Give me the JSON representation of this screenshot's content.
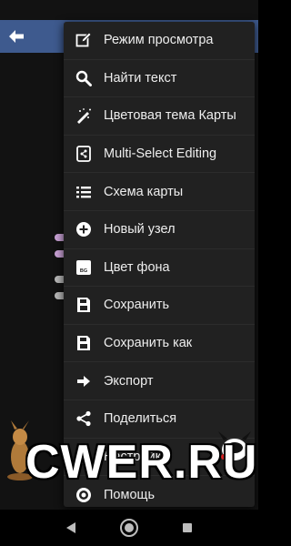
{
  "menu": {
    "items": [
      {
        "label": "Режим просмотра",
        "icon": "edit-icon"
      },
      {
        "label": "Найти текст",
        "icon": "search-icon"
      },
      {
        "label": "Цветовая тема Карты",
        "icon": "magic-brush-icon"
      },
      {
        "label": "Multi-Select Editing",
        "icon": "multi-select-icon"
      },
      {
        "label": "Схема карты",
        "icon": "list-icon"
      },
      {
        "label": "Новый узел",
        "icon": "add-circle-icon"
      },
      {
        "label": "Цвет фона",
        "icon": "bg-color-icon",
        "icon_text": "BG"
      },
      {
        "label": "Сохранить",
        "icon": "save-icon"
      },
      {
        "label": "Сохранить как",
        "icon": "save-as-icon"
      },
      {
        "label": "Экспорт",
        "icon": "export-arrow-icon"
      },
      {
        "label": "Поделиться",
        "icon": "share-icon"
      },
      {
        "label": "Настройки",
        "icon": "settings-icon"
      },
      {
        "label": "Помощь",
        "icon": "help-icon"
      }
    ]
  },
  "watermark": {
    "text": "CWER.RU"
  },
  "colors": {
    "appbar": "#3e5a8e",
    "menu_bg": "#212121",
    "text": "#eeeeee",
    "node_purple": "#c9a2d6",
    "node_gray": "#b8b8b8"
  }
}
